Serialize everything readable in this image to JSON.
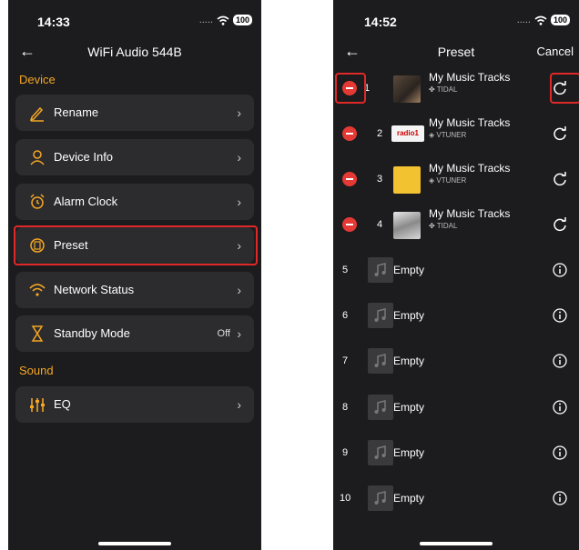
{
  "left": {
    "status": {
      "time": "14:33",
      "battery": "100",
      "dots": "....."
    },
    "nav": {
      "title": "WiFi Audio 544B"
    },
    "sections": {
      "device": "Device",
      "sound": "Sound"
    },
    "items": {
      "rename": "Rename",
      "device_info": "Device Info",
      "alarm_clock": "Alarm Clock",
      "preset": "Preset",
      "network_status": "Network Status",
      "standby_mode": "Standby Mode",
      "standby_value": "Off",
      "eq": "EQ"
    },
    "colors": {
      "accent": "#f5a623",
      "highlight": "#e02828"
    }
  },
  "right": {
    "status": {
      "time": "14:52",
      "battery": "100",
      "dots": "....."
    },
    "nav": {
      "title": "Preset",
      "cancel": "Cancel"
    },
    "presets": [
      {
        "num": "1",
        "title": "My Music Tracks",
        "source": "TIDAL"
      },
      {
        "num": "2",
        "title": "My Music Tracks",
        "source": "VTUNER",
        "thumb_text": "radio1"
      },
      {
        "num": "3",
        "title": "My Music Tracks",
        "source": "VTUNER"
      },
      {
        "num": "4",
        "title": "My Music Tracks",
        "source": "TIDAL"
      }
    ],
    "empty": [
      {
        "num": "5",
        "label": "Empty"
      },
      {
        "num": "6",
        "label": "Empty"
      },
      {
        "num": "7",
        "label": "Empty"
      },
      {
        "num": "8",
        "label": "Empty"
      },
      {
        "num": "9",
        "label": "Empty"
      },
      {
        "num": "10",
        "label": "Empty"
      }
    ]
  }
}
